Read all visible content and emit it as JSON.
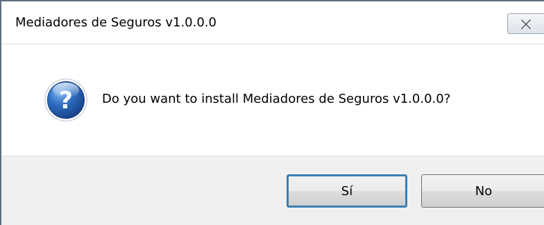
{
  "window": {
    "title": "Mediadores de Seguros v1.0.0.0",
    "close_icon": "close-icon"
  },
  "dialog": {
    "icon": "question-icon",
    "message": "Do you want to install Mediadores de Seguros v1.0.0.0?"
  },
  "buttons": {
    "yes_label": "Sí",
    "no_label": "No"
  },
  "colors": {
    "accent": "#3c7fb1",
    "icon_blue": "#1f5aa6",
    "footer_bg": "#f0f0f0"
  }
}
